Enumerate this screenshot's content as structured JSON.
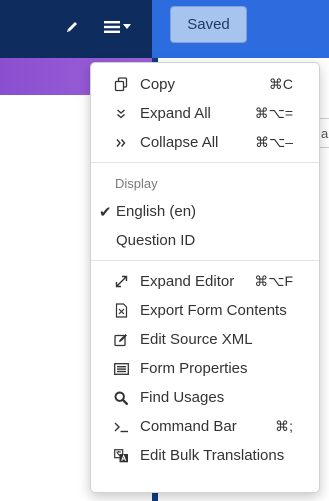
{
  "toolbar": {
    "saved_label": "Saved",
    "pencil_icon": "pencil-icon",
    "menu_icon": "hamburger-icon"
  },
  "peek_text": "al",
  "menu": {
    "items_top": [
      {
        "icon": "copy-icon",
        "label": "Copy",
        "shortcut": "⌘C"
      },
      {
        "icon": "expand-all-icon",
        "label": "Expand All",
        "shortcut": "⌘⌥="
      },
      {
        "icon": "collapse-all-icon",
        "label": "Collapse All",
        "shortcut": "⌘⌥–"
      }
    ],
    "display_header": "Display",
    "display_options": [
      {
        "label": "English (en)",
        "checked": true
      },
      {
        "label": "Question ID",
        "checked": false
      }
    ],
    "items_bottom": [
      {
        "icon": "expand-editor-icon",
        "label": "Expand Editor",
        "shortcut": "⌘⌥F"
      },
      {
        "icon": "export-icon",
        "label": "Export Form Contents",
        "shortcut": ""
      },
      {
        "icon": "edit-source-icon",
        "label": "Edit Source XML",
        "shortcut": ""
      },
      {
        "icon": "form-properties-icon",
        "label": "Form Properties",
        "shortcut": ""
      },
      {
        "icon": "search-icon",
        "label": "Find Usages",
        "shortcut": ""
      },
      {
        "icon": "terminal-icon",
        "label": "Command Bar",
        "shortcut": "⌘;"
      },
      {
        "icon": "translate-icon",
        "label": "Edit Bulk Translations",
        "shortcut": ""
      }
    ]
  },
  "colors": {
    "topbar_dark": "#0f2c5f",
    "topbar_blue": "#2d6cdf",
    "purple_band": "#8a4fcf",
    "saved_bg": "#a7c4ee"
  }
}
